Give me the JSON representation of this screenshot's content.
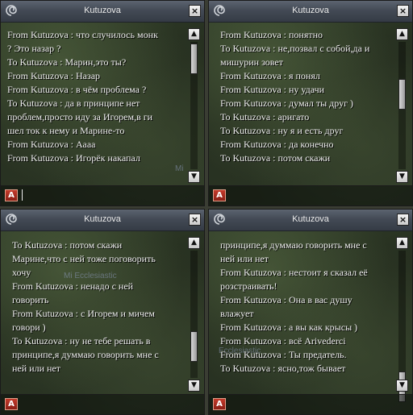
{
  "windows": [
    {
      "title": "Kutuzova",
      "close_icon": "×",
      "lines": [
        "From Kutuzova : что случилось монк",
        "? Это назар ?",
        "To Kutuzova : Марин,это ты?",
        "From Kutuzova : Назар",
        "From Kutuzova : в чём проблема ?",
        "To Kutuzova : да в принципе нет",
        "проблем,просто иду за Игорем,в ги",
        "шел ток к нему и Марине-то",
        "From Kutuzova : Аааа",
        "From Kutuzova : Игорёк накапал"
      ],
      "background_label": "Mi",
      "scroll_up": "▲",
      "scroll_down": "▼",
      "input_button": "A"
    },
    {
      "title": "Kutuzova",
      "close_icon": "×",
      "lines": [
        "From Kutuzova : понятно",
        "To Kutuzova : не,позвал с собой,да и",
        "мишурин зовет",
        "From Kutuzova : я понял",
        "From Kutuzova : ну удачи",
        "From Kutuzova : думал ты друг )",
        "To Kutuzova : аригато",
        "To Kutuzova : ну я и есть друг",
        "From Kutuzova : да конечно",
        "To Kutuzova : потом скажи"
      ],
      "scroll_up": "▲",
      "scroll_down": "▼",
      "input_button": "A"
    },
    {
      "title": "Kutuzova",
      "close_icon": "×",
      "lines": [
        "To Kutuzova : потом скажи",
        "Марине,что с ней тоже поговорить",
        "хочу",
        "From Kutuzova : ненадо с ней",
        "говорить",
        "From Kutuzova : с Игорем и мичем",
        "говори )",
        "To Kutuzova : ну не тебе решать в",
        "принципе,я думмаю говорить мне с",
        "ней или нет"
      ],
      "background_label": "Mi Ecclesiastic",
      "scroll_up": "▲",
      "scroll_down": "▼",
      "input_button": "A"
    },
    {
      "title": "Kutuzova",
      "close_icon": "×",
      "lines": [
        "принципе,я думмаю говорить мне с",
        "ней или нет",
        "From Kutuzova : нестоит я сказал её",
        "розстраивать!",
        "From Kutuzova : Она в  вас душу",
        "влажует",
        "From Kutuzova : а вы как крысы )",
        "From Kutuzova : всё Arivederci",
        "From Kutuzova : Ты предатель.",
        "To Kutuzova : ясно,тож бывает"
      ],
      "background_label": "Ecclesiastic",
      "scroll_up": "▲",
      "scroll_down": "▼",
      "input_button": "A"
    }
  ]
}
